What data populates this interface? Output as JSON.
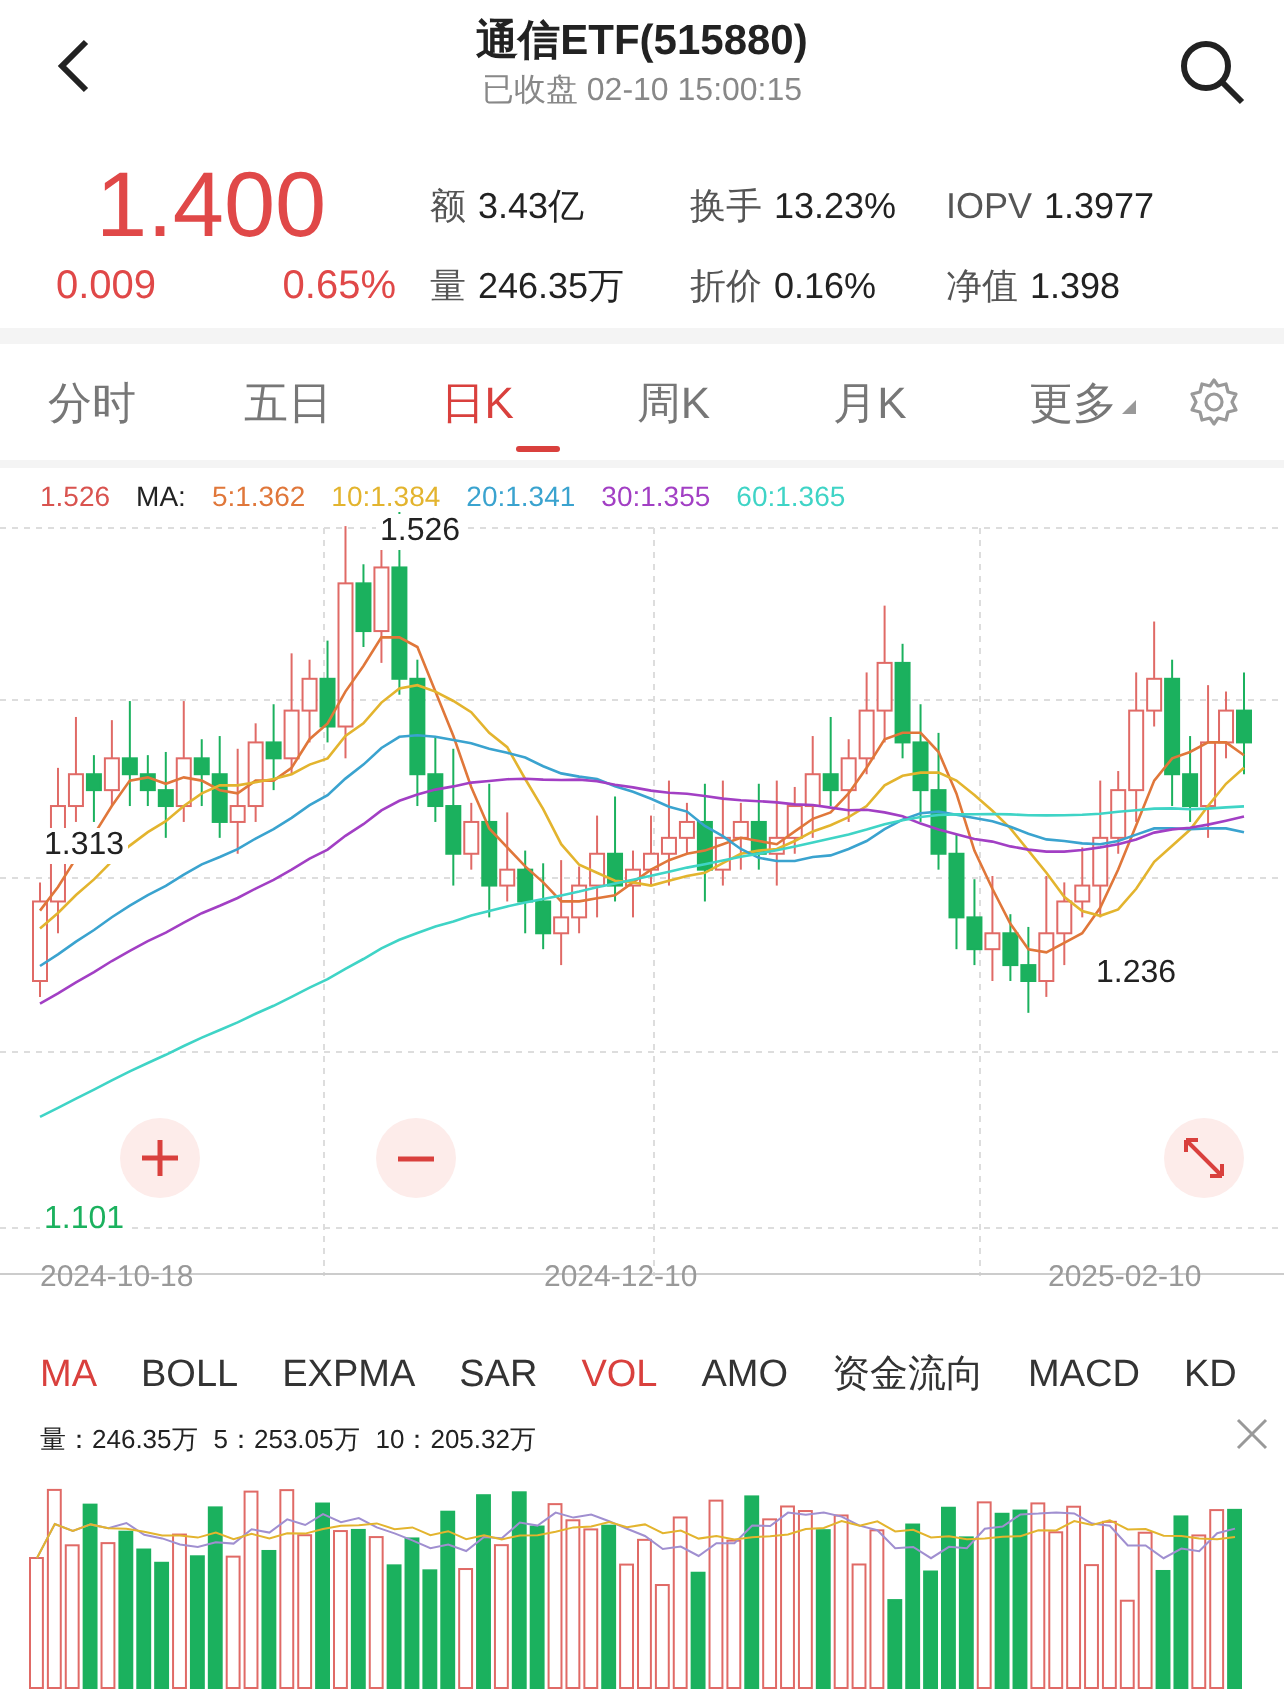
{
  "header": {
    "title": "通信ETF(515880)",
    "subtitle": "已收盘 02-10 15:00:15"
  },
  "quote": {
    "price": "1.400",
    "change": "0.009",
    "change_pct": "0.65%",
    "stats": [
      {
        "label": "额",
        "value": "3.43亿"
      },
      {
        "label": "换手",
        "value": "13.23%"
      },
      {
        "label": "IOPV",
        "value": "1.3977"
      },
      {
        "label": "量",
        "value": "246.35万"
      },
      {
        "label": "折价",
        "value": "0.16%"
      },
      {
        "label": "净值",
        "value": "1.398"
      }
    ]
  },
  "period_tabs": [
    {
      "label": "分时",
      "selected": false,
      "kind": "tab"
    },
    {
      "label": "五日",
      "selected": false,
      "kind": "tab"
    },
    {
      "label": "日K",
      "selected": true,
      "kind": "tab"
    },
    {
      "label": "周K",
      "selected": false,
      "kind": "tab"
    },
    {
      "label": "月K",
      "selected": false,
      "kind": "tab"
    },
    {
      "label": "更多",
      "selected": false,
      "kind": "menu"
    }
  ],
  "kline": {
    "top_label": "1.526",
    "ma_label": "MA:",
    "ma": [
      {
        "text": "5:1.362",
        "color": "#e0773a"
      },
      {
        "text": "10:1.384",
        "color": "#e3b42e"
      },
      {
        "text": "20:1.341",
        "color": "#3aa3cf"
      },
      {
        "text": "30:1.355",
        "color": "#a23fc4"
      },
      {
        "text": "60:1.365",
        "color": "#3fd4c6"
      }
    ],
    "high_marker": "1.526",
    "left_label": "1.313",
    "low_marker": "1.236",
    "bottom_label": "1.101",
    "dates": [
      "2024-10-18",
      "2024-12-10",
      "2025-02-10"
    ]
  },
  "indicator_tabs": [
    {
      "label": "MA",
      "selected": true
    },
    {
      "label": "BOLL",
      "selected": false
    },
    {
      "label": "EXPMA",
      "selected": false
    },
    {
      "label": "SAR",
      "selected": false
    },
    {
      "label": "VOL",
      "selected": true
    },
    {
      "label": "AMO",
      "selected": false
    },
    {
      "label": "资金流向",
      "selected": false
    },
    {
      "label": "MACD",
      "selected": false
    },
    {
      "label": "KD",
      "selected": false
    }
  ],
  "volume": {
    "legend": [
      "量：246.35万",
      "5：253.05万",
      "10：205.32万"
    ]
  }
}
